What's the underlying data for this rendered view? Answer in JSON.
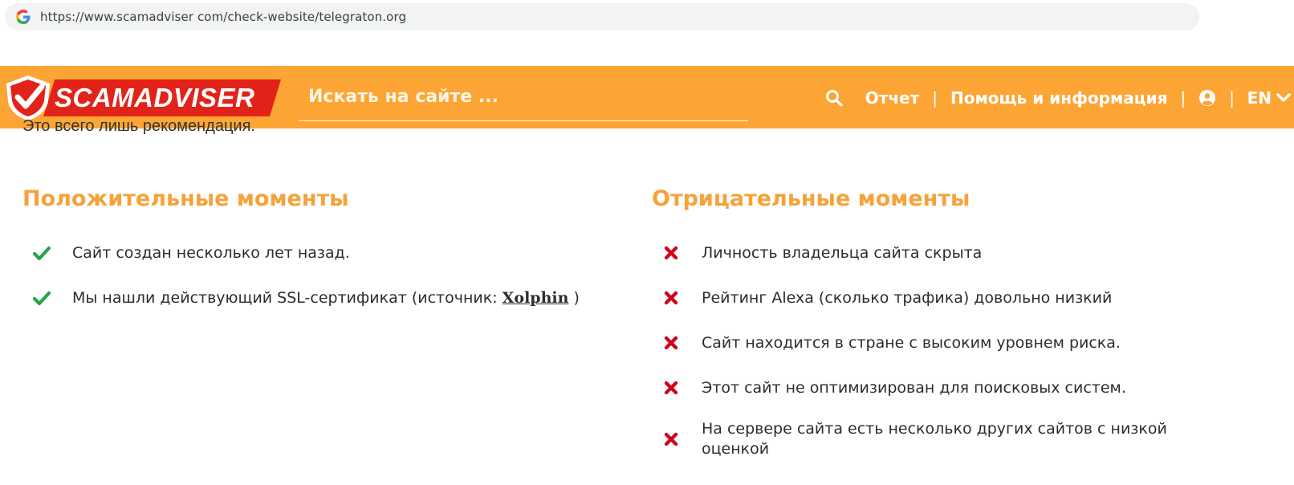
{
  "browser": {
    "url": "https://www.scamadviser com/check-website/telegraton.org",
    "favicon_icon": "google-g-icon"
  },
  "header": {
    "logo_text": "SCAMADVISER",
    "search_placeholder": "Искать на сайте ...",
    "nav": {
      "report": "Отчет",
      "help": "Помощь и информация",
      "lang": "EN",
      "separator": "|"
    },
    "colors": {
      "header_bg": "#fda534",
      "logo_red": "#e2231a"
    }
  },
  "cutoff_text": "Это всего лишь рекомендация.",
  "positive": {
    "title": "Положительные моменты",
    "items": [
      {
        "text": "Сайт создан несколько лет назад."
      },
      {
        "text_before": "Мы нашли действующий SSL-сертификат (источник: ",
        "link": "Xolphin",
        "text_after": " )"
      }
    ],
    "icon": "check-icon",
    "color": "#2aa24b"
  },
  "negative": {
    "title": "Отрицательные моменты",
    "items": [
      "Личность владельца сайта скрыта",
      "Рейтинг Alexa (сколько трафика) довольно низкий",
      "Сайт находится в стране с высоким уровнем риска.",
      "Этот сайт не оптимизирован для поисковых систем.",
      "На сервере сайта есть несколько других сайтов с низкой оценкой"
    ],
    "icon": "cross-icon",
    "color": "#d0021b"
  }
}
